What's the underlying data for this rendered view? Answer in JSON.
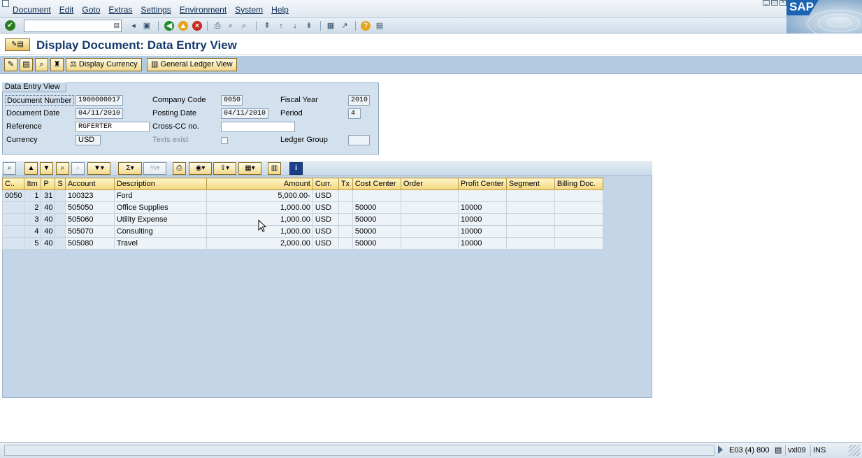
{
  "menu": {
    "items": [
      "Document",
      "Edit",
      "Goto",
      "Extras",
      "Settings",
      "Environment",
      "System",
      "Help"
    ]
  },
  "logo": {
    "text": "SAP"
  },
  "toolbar": {
    "command_field_value": "",
    "icons": [
      "check-icon",
      "save-icon",
      "back-icon",
      "exit-icon",
      "cancel-icon",
      "print-icon",
      "find-icon",
      "find-next-icon",
      "first-page-icon",
      "previous-page-icon",
      "next-page-icon",
      "last-page-icon",
      "new-session-icon",
      "shortcut-icon",
      "help-icon",
      "customize-icon"
    ]
  },
  "title": "Display Document: Data Entry View",
  "app_toolbar": {
    "display_currency": "Display Currency",
    "general_ledger_view": "General Ledger View"
  },
  "header": {
    "tab_label": "Data Entry View",
    "document_number_label": "Document Number",
    "document_number": "1900000017",
    "company_code_label": "Company Code",
    "company_code": "0050",
    "fiscal_year_label": "Fiscal Year",
    "fiscal_year": "2010",
    "document_date_label": "Document Date",
    "document_date": "04/11/2010",
    "posting_date_label": "Posting Date",
    "posting_date": "04/11/2010",
    "period_label": "Period",
    "period": "4",
    "reference_label": "Reference",
    "reference": "RGFERTER",
    "cross_cc_label": "Cross-CC no.",
    "cross_cc": "",
    "currency_label": "Currency",
    "currency": "USD",
    "texts_exist_label": "Texts exist",
    "ledger_group_label": "Ledger Group",
    "ledger_group": ""
  },
  "grid": {
    "columns": [
      "C..",
      "Itm",
      "P",
      "S",
      "Account",
      "Description",
      "Amount",
      "Curr.",
      "Tx",
      "Cost Center",
      "Order",
      "Profit Center",
      "Segment",
      "Billing Doc."
    ],
    "rows": [
      [
        "0050",
        "1",
        "31",
        "",
        "100323",
        "Ford",
        "5,000.00-",
        "USD",
        "",
        "",
        "",
        "",
        "",
        ""
      ],
      [
        "",
        "2",
        "40",
        "",
        "505050",
        "Office Supplies",
        "1,000.00",
        "USD",
        "",
        "50000",
        "",
        "10000",
        "",
        ""
      ],
      [
        "",
        "3",
        "40",
        "",
        "505060",
        "Utility Expense",
        "1,000.00",
        "USD",
        "",
        "50000",
        "",
        "10000",
        "",
        ""
      ],
      [
        "",
        "4",
        "40",
        "",
        "505070",
        "Consulting",
        "1,000.00",
        "USD",
        "",
        "50000",
        "",
        "10000",
        "",
        ""
      ],
      [
        "",
        "5",
        "40",
        "",
        "505080",
        "Travel",
        "2,000.00",
        "USD",
        "",
        "50000",
        "",
        "10000",
        "",
        ""
      ]
    ]
  },
  "status": {
    "message": "",
    "system": "E03 (4) 800",
    "server": "vxl09",
    "mode": "INS"
  }
}
